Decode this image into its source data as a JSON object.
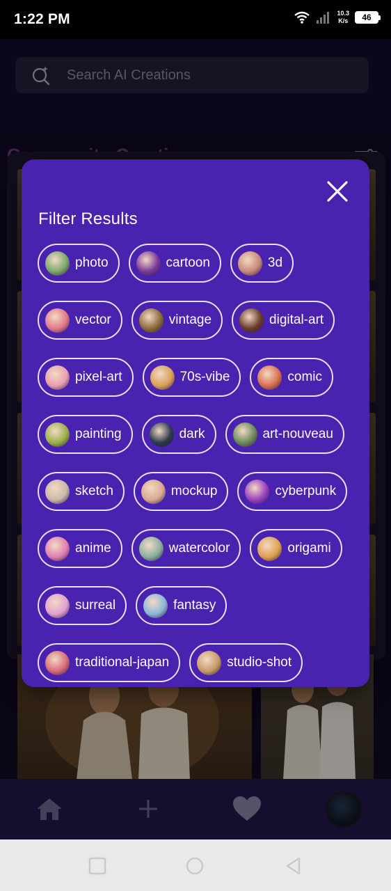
{
  "status_bar": {
    "time": "1:22 PM",
    "speed_value": "10.3",
    "speed_unit": "K/s",
    "battery": "46"
  },
  "search": {
    "placeholder": "Search AI Creations"
  },
  "section": {
    "title": "Community Creations"
  },
  "filter_modal": {
    "title": "Filter Results",
    "rows": [
      [
        {
          "label": "photo",
          "thumb": "#7ba86b"
        },
        {
          "label": "cartoon",
          "thumb": "#7a3a9a"
        },
        {
          "label": "3d",
          "thumb": "#c98a7a"
        }
      ],
      [
        {
          "label": "vector",
          "thumb": "#e07a8a"
        },
        {
          "label": "vintage",
          "thumb": "#8a6b3a"
        },
        {
          "label": "digital-art",
          "thumb": "#6a3a2a"
        }
      ],
      [
        {
          "label": "pixel-art",
          "thumb": "#e8a0b0"
        },
        {
          "label": "70s-vibe",
          "thumb": "#d9a05a"
        },
        {
          "label": "comic",
          "thumb": "#d97050"
        }
      ],
      [
        {
          "label": "painting",
          "thumb": "#9ab04a"
        },
        {
          "label": "dark",
          "thumb": "#2a3a4a"
        },
        {
          "label": "art-nouveau",
          "thumb": "#6a8a5a"
        }
      ],
      [
        {
          "label": "sketch",
          "thumb": "#c9b8a8"
        },
        {
          "label": "mockup",
          "thumb": "#d9a890"
        },
        {
          "label": "cyberpunk",
          "thumb": "#9a40c0"
        }
      ],
      [
        {
          "label": "anime",
          "thumb": "#e080b0"
        },
        {
          "label": "watercolor",
          "thumb": "#8ab0a0"
        },
        {
          "label": "origami",
          "thumb": "#e0a050"
        }
      ],
      [
        {
          "label": "surreal",
          "thumb": "#e0a0d0"
        },
        {
          "label": "fantasy",
          "thumb": "#8ab8d8"
        }
      ],
      [
        {
          "label": "traditional-japan",
          "thumb": "#d86a7a"
        },
        {
          "label": "studio-shot",
          "thumb": "#c99a6a"
        }
      ]
    ]
  },
  "bottom_nav": {
    "items": [
      "home-icon",
      "plus-icon",
      "heart-icon",
      "profile-avatar"
    ]
  },
  "colors": {
    "modal_bg": "#4a22b0",
    "chip_border": "#e8e2ff",
    "nav_bg": "#24184d"
  }
}
